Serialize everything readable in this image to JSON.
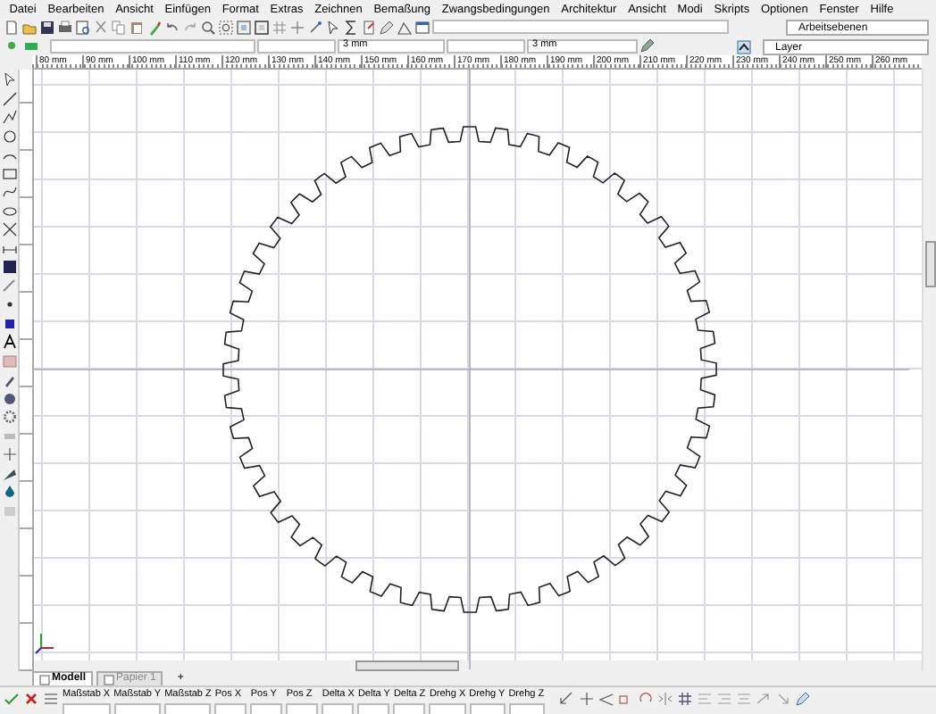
{
  "menu": [
    "Datei",
    "Bearbeiten",
    "Ansicht",
    "Einfügen",
    "Format",
    "Extras",
    "Zeichnen",
    "Bemaßung",
    "Zwangsbedingungen",
    "Architektur",
    "Ansicht",
    "Modi",
    "Skripts",
    "Optionen",
    "Fenster",
    "Hilfe"
  ],
  "toolbar_fields": [
    {
      "value": "3 mm"
    },
    {
      "value": "3 mm"
    }
  ],
  "workplanes": "Arbeitsebenen",
  "layer": "Layer",
  "ruler_labels": [
    "80 mm",
    "90 mm",
    "100 mm",
    "110 mm",
    "120 mm",
    "130 mm",
    "140 mm",
    "150 mm",
    "160 mm",
    "170 mm",
    "180 mm",
    "190 mm",
    "200 mm",
    "210 mm",
    "220 mm",
    "230 mm",
    "240 mm",
    "250 mm",
    "260 mm"
  ],
  "tabs": [
    {
      "label": "Modell",
      "selected": true
    },
    {
      "label": "Papier 1",
      "selected": false
    }
  ],
  "add_tab": "+",
  "status_bar": {
    "fields": [
      "Maßstab X",
      "Maßstab Y",
      "Maßstab Z",
      "Pos X",
      "Pos Y",
      "Pos Z",
      "Delta X",
      "Delta Y",
      "Delta Z",
      "Drehg X",
      "Drehg Y",
      "Drehg Z"
    ]
  }
}
